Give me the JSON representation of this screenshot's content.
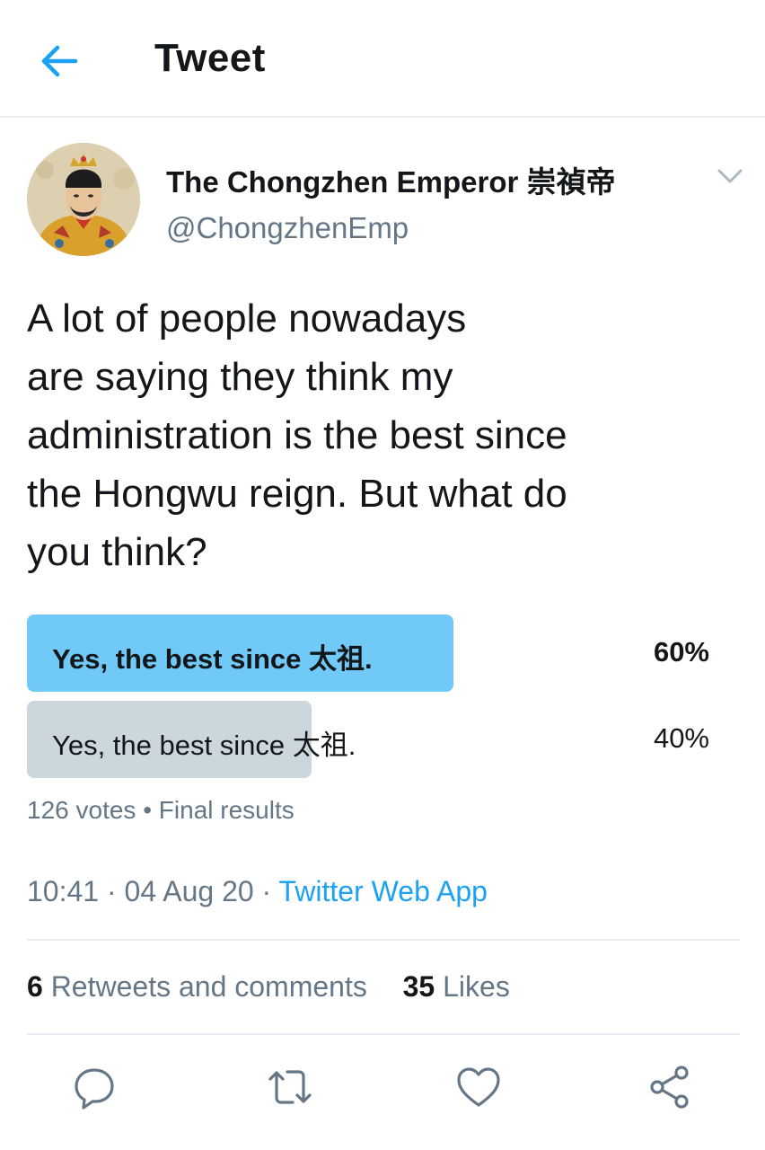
{
  "header": {
    "title": "Tweet"
  },
  "author": {
    "name": "The Chongzhen Emperor 崇禎帝",
    "handle": "@ChongzhenEmp"
  },
  "tweet": {
    "lines": [
      "A lot of people nowadays",
      "are saying they think my",
      "administration is the best since",
      "the Hongwu reign. But what do",
      "you think?"
    ]
  },
  "poll": {
    "options": [
      {
        "label": "Yes, the best since 太祖.",
        "percent": "60%",
        "fraction": 0.6,
        "color": "#71c9f8"
      },
      {
        "label": "Yes, the best since 太祖.",
        "percent": "40%",
        "fraction": 0.4,
        "color": "#ccd6dd"
      }
    ],
    "votes": "126 votes",
    "separator": "•",
    "status": "Final results"
  },
  "meta": {
    "time": "10:41",
    "sep1": "·",
    "date": "04 Aug 20",
    "sep2": "·",
    "source": "Twitter Web App"
  },
  "stats": {
    "retweets_count": "6",
    "retweets_label": "Retweets and comments",
    "likes_count": "35",
    "likes_label": "Likes"
  },
  "colors": {
    "accent": "#1da1f2",
    "secondary_text": "#657786",
    "divider": "#e6ecf0"
  },
  "icons": {
    "back": "arrow-left-icon",
    "caret": "chevron-down-icon",
    "reply": "reply-icon",
    "retweet": "retweet-icon",
    "like": "heart-icon",
    "share": "share-icon"
  }
}
